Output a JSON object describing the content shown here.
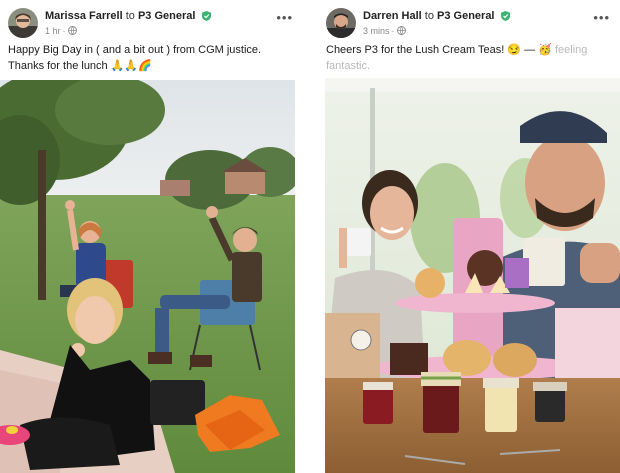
{
  "posts": [
    {
      "author": "Marissa Farrell",
      "to": "to",
      "group": "P3 General",
      "time": "1 hr",
      "message": "Happy Big Day in ( and a bit out ) from CGM justice. Thanks for the lunch 🙏🙏🌈",
      "more": "•••",
      "photo_icon": "park-group-photo",
      "avatar_icon": "avatar-photo"
    },
    {
      "author": "Darren Hall",
      "to": "to",
      "group": "P3 General",
      "time": "3 mins",
      "message": "Cheers P3 for the Lush Cream Teas! 😏 — 🥳",
      "message_faded": " feeling fantastic.",
      "more": "•••",
      "photo_icon": "cream-tea-selfie-photo",
      "avatar_icon": "avatar-photo"
    }
  ],
  "colors": {
    "shield": "#3cb371",
    "meta": "#8a8a8a"
  }
}
